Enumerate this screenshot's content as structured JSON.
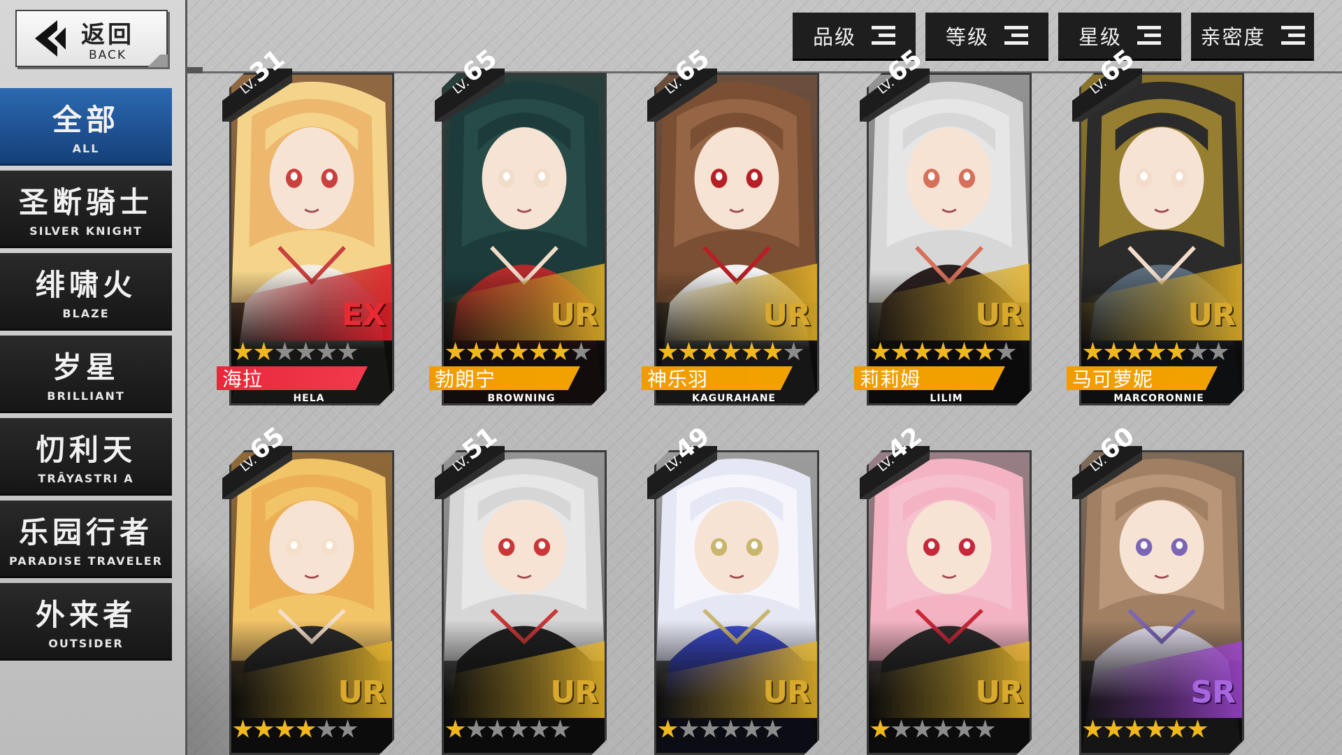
{
  "back": {
    "zh": "返回",
    "en": "BACK"
  },
  "sort_buttons": [
    {
      "label": "品级"
    },
    {
      "label": "等级"
    },
    {
      "label": "星级"
    },
    {
      "label": "亲密度"
    }
  ],
  "categories": [
    {
      "zh": "全部",
      "en": "ALL",
      "active": true
    },
    {
      "zh": "圣断骑士",
      "en": "SILVER KNIGHT"
    },
    {
      "zh": "绯啸火",
      "en": "BLAZE"
    },
    {
      "zh": "岁星",
      "en": "BRILLIANT"
    },
    {
      "zh": "忉利天",
      "en": "TRÂYASTRI A"
    },
    {
      "zh": "乐园行者",
      "en": "PARADISE TRAVELER"
    },
    {
      "zh": "外来者",
      "en": "OUTSIDER"
    }
  ],
  "cards": [
    {
      "lv": "31",
      "rarity": "EX",
      "stars": 2,
      "max_stars": 6,
      "name_zh": "海拉",
      "name_en": "HELA",
      "palette": [
        "#f4d48a",
        "#e9a35c",
        "#f2ece2",
        "#c9413f"
      ]
    },
    {
      "lv": "65",
      "rarity": "UR",
      "stars": 6,
      "max_stars": 7,
      "name_zh": "勃朗宁",
      "name_en": "BROWNING",
      "palette": [
        "#1c3b3a",
        "#2e5750",
        "#b22a2a",
        "#f1dcc8"
      ]
    },
    {
      "lv": "65",
      "rarity": "UR",
      "stars": 6,
      "max_stars": 7,
      "name_zh": "神乐羽",
      "name_en": "KAGURAHANE",
      "palette": [
        "#7a4f33",
        "#a87454",
        "#f2f2f2",
        "#b81f25"
      ]
    },
    {
      "lv": "65",
      "rarity": "UR",
      "stars": 6,
      "max_stars": 7,
      "name_zh": "莉莉姆",
      "name_en": "LILIM",
      "palette": [
        "#d7d7d7",
        "#f0f0f0",
        "#2a1f1f",
        "#d6705a"
      ]
    },
    {
      "lv": "65",
      "rarity": "UR",
      "stars": 5,
      "max_stars": 7,
      "name_zh": "马可萝妮",
      "name_en": "MARCORONNIE",
      "palette": [
        "#2b2b2b",
        "#e0b836",
        "#5b6b7a",
        "#f4dccb"
      ]
    },
    {
      "lv": "65",
      "rarity": "UR",
      "stars": 4,
      "max_stars": 6,
      "name_zh": "",
      "name_en": "",
      "palette": [
        "#f2c468",
        "#e7a24a",
        "#2a2a2a",
        "#f6dfc9"
      ]
    },
    {
      "lv": "51",
      "rarity": "UR",
      "stars": 1,
      "max_stars": 6,
      "name_zh": "",
      "name_en": "",
      "palette": [
        "#d6d6d6",
        "#f1f1f1",
        "#202020",
        "#c93737"
      ]
    },
    {
      "lv": "49",
      "rarity": "UR",
      "stars": 1,
      "max_stars": 6,
      "name_zh": "",
      "name_en": "",
      "palette": [
        "#e5e7f4",
        "#ffffff",
        "#3b49c8",
        "#c9b66e"
      ]
    },
    {
      "lv": "42",
      "rarity": "UR",
      "stars": 1,
      "max_stars": 6,
      "name_zh": "",
      "name_en": "",
      "palette": [
        "#f4b3c3",
        "#f7cad5",
        "#2a2a2a",
        "#c7283a"
      ]
    },
    {
      "lv": "60",
      "rarity": "SR",
      "stars": 6,
      "max_stars": 6,
      "name_zh": "",
      "name_en": "",
      "palette": [
        "#a07f63",
        "#c9a586",
        "#e5e0f0",
        "#7c66b4"
      ]
    }
  ]
}
